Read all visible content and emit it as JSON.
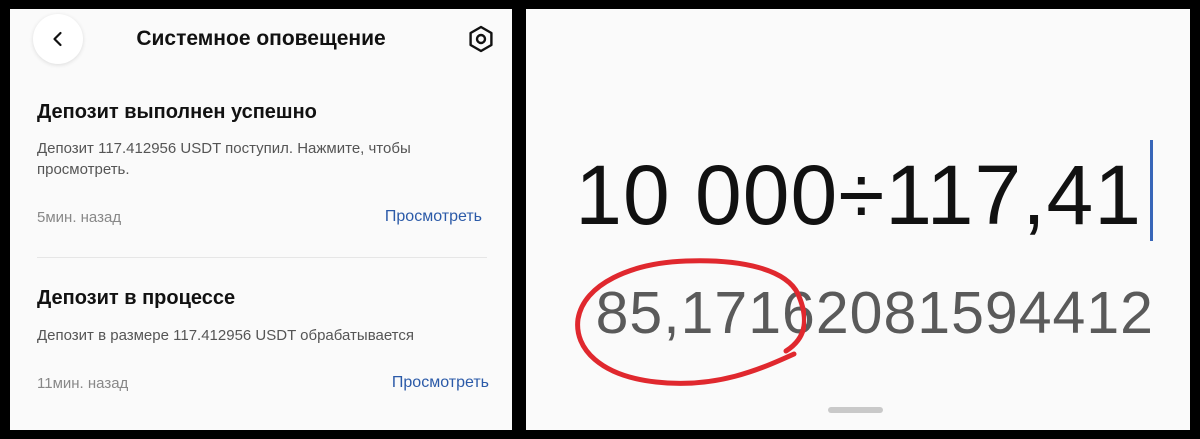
{
  "notifications_screen": {
    "title": "Системное оповещение",
    "back_icon": "chevron-left-icon",
    "settings_icon": "gear-icon",
    "items": [
      {
        "title": "Депозит выполнен успешно",
        "body": "Депозит 117.412956 USDT поступил. Нажмите, чтобы просмотреть.",
        "time": "5мин. назад",
        "action": "Просмотреть"
      },
      {
        "title": "Депозит в процессе",
        "body": "Депозит в размере 117.412956 USDT обрабатывается",
        "time": "11мин. назад",
        "action": "Просмотреть"
      }
    ]
  },
  "calculator": {
    "expression": "10 000÷117,41",
    "result": "85,1716208159441​2",
    "annotation_color": "#e0282e",
    "cursor_color": "#3866b8"
  }
}
